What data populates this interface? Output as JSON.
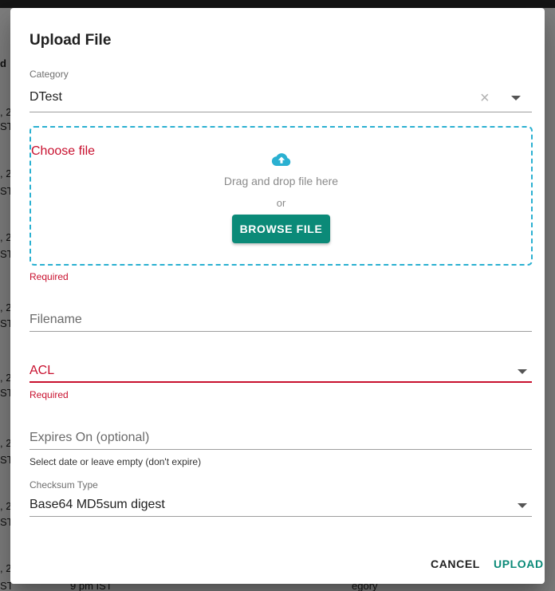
{
  "background": {
    "fragments": [
      "d",
      ", 2",
      "ST",
      ", 2",
      "ST",
      ", 2",
      "ST",
      ", 2",
      "ST",
      ", 2",
      "ST",
      ", 2",
      "ST",
      ", 2",
      "ST",
      ", 2",
      "ST",
      "9 pm IST",
      "egory"
    ]
  },
  "dialog": {
    "title": "Upload File",
    "category": {
      "label": "Category",
      "value": "DTest",
      "clear_icon": "close-icon",
      "dropdown_icon": "chevron-down-icon"
    },
    "dropzone": {
      "choose_label": "Choose file",
      "icon": "cloud-upload-icon",
      "drag_text": "Drag and drop file here",
      "or_text": "or",
      "browse_label": "BROWSE FILE",
      "error": "Required"
    },
    "filename": {
      "placeholder": "Filename",
      "value": ""
    },
    "acl": {
      "placeholder": "ACL",
      "error": "Required",
      "dropdown_icon": "chevron-down-icon"
    },
    "expires": {
      "placeholder": "Expires On (optional)",
      "helper": "Select date or leave empty (don't expire)"
    },
    "checksum": {
      "label": "Checksum Type",
      "value": "Base64 MD5sum digest",
      "dropdown_icon": "chevron-down-icon"
    },
    "actions": {
      "cancel": "CANCEL",
      "upload": "UPLOAD"
    }
  },
  "colors": {
    "accent": "#0b8a78",
    "error": "#c8102e",
    "dropzone_border": "#2ab0d1",
    "cloud_icon": "#2ab0d1"
  }
}
